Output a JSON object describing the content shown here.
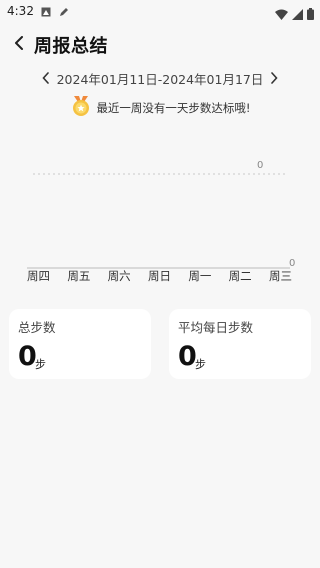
{
  "status_bar": {
    "time": "4:32"
  },
  "header": {
    "title": "周报总结",
    "back_icon": "chevron-left-icon"
  },
  "date_range": {
    "text": "2024年01月11日-2024年01月17日"
  },
  "notice": {
    "text": "最近一周没有一天步数达标哦!",
    "icon": "trophy-medal-icon"
  },
  "chart_data": {
    "type": "line",
    "categories": [
      "周四",
      "周五",
      "周六",
      "周日",
      "周一",
      "周二",
      "周三"
    ],
    "values": [
      0,
      0,
      0,
      0,
      0,
      0,
      0
    ],
    "goal_line_label": "0",
    "last_value_label": "0",
    "colors": {
      "axis": "#bbbbbb",
      "goal_line": "#c8c8c8"
    }
  },
  "stats": {
    "total_steps": {
      "label": "总步数",
      "value": "0",
      "unit": "步"
    },
    "avg_steps": {
      "label": "平均每日步数",
      "value": "0",
      "unit": "步"
    }
  },
  "colors": {
    "background": "#f7f7f7",
    "card": "#ffffff",
    "medal_gold": "#f5c242"
  }
}
